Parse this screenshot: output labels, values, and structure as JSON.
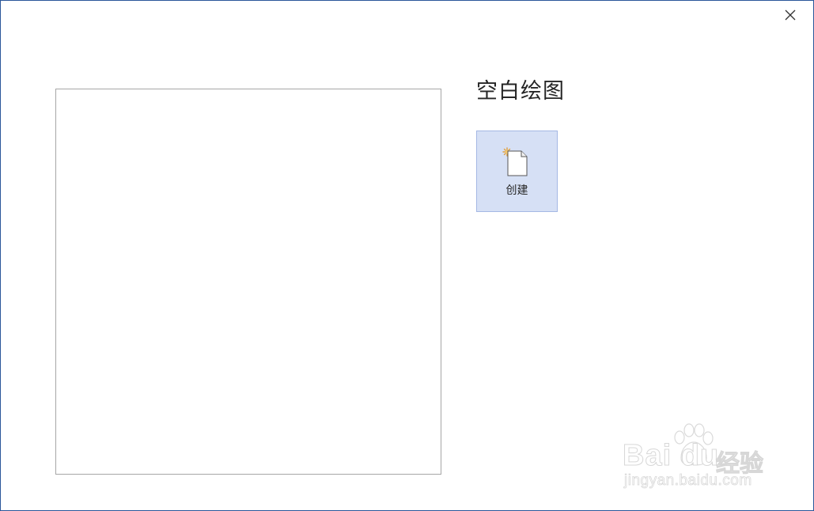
{
  "dialog": {
    "template_title": "空白绘图",
    "create_label": "创建",
    "close_icon": "close-icon",
    "new_document_icon": "new-document-icon"
  },
  "watermark": {
    "brand": "Bai du",
    "suffix": "经验",
    "url": "jingyan.baidu.com"
  },
  "colors": {
    "window_border": "#2b579a",
    "create_button_bg": "#d6e0f5",
    "create_button_border": "#a5b8e4",
    "preview_border": "#a6a6a6"
  }
}
